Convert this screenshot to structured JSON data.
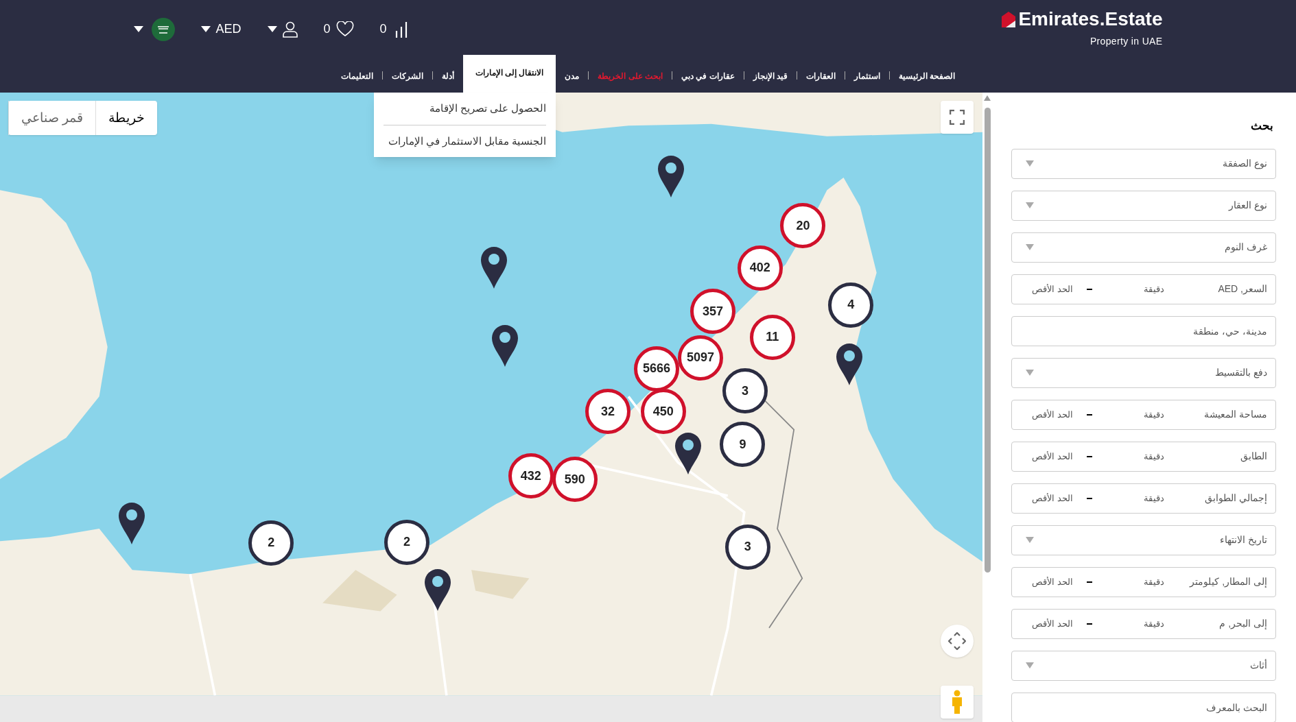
{
  "header": {
    "logo": {
      "title": "Emirates.Estate",
      "tagline": "Property in UAE"
    },
    "compare_count": "0",
    "favorites_count": "0",
    "currency": "AED"
  },
  "nav": [
    {
      "label": "الصفحة الرئيسية",
      "selected": false,
      "highlight": false
    },
    {
      "label": "استثمار",
      "selected": false,
      "highlight": false
    },
    {
      "label": "العقارات",
      "selected": false,
      "highlight": false
    },
    {
      "label": "قيد الإنجاز",
      "selected": false,
      "highlight": false
    },
    {
      "label": "عقارات في دبي",
      "selected": false,
      "highlight": false
    },
    {
      "label": "ابحث على الخريطة",
      "selected": false,
      "highlight": true
    },
    {
      "label": "مدن",
      "selected": false,
      "highlight": false
    },
    {
      "label": "الانتقال إلى الإمارات",
      "selected": true,
      "highlight": false,
      "submenu": [
        "الحصول على تصريح الإقامة",
        "الجنسية مقابل الاستثمار في الإمارات"
      ]
    },
    {
      "label": "أدلة",
      "selected": false,
      "highlight": false
    },
    {
      "label": "الشركات",
      "selected": false,
      "highlight": false
    },
    {
      "label": "التعليمات",
      "selected": false,
      "highlight": false
    }
  ],
  "map": {
    "map_types": [
      {
        "label": "خريطة",
        "selected": true
      },
      {
        "label": "قمر صناعي",
        "selected": false
      }
    ],
    "clusters": [
      {
        "count": "20",
        "color": "#d0112b"
      },
      {
        "count": "402",
        "color": "#d0112b"
      },
      {
        "count": "4",
        "color": "#2b2d42"
      },
      {
        "count": "357",
        "color": "#d0112b"
      },
      {
        "count": "11",
        "color": "#d0112b"
      },
      {
        "count": "5097",
        "color": "#d0112b"
      },
      {
        "count": "5666",
        "color": "#d0112b"
      },
      {
        "count": "3",
        "color": "#2b2d42"
      },
      {
        "count": "32",
        "color": "#d0112b"
      },
      {
        "count": "450",
        "color": "#d0112b"
      },
      {
        "count": "9",
        "color": "#2b2d42"
      },
      {
        "count": "432",
        "color": "#d0112b"
      },
      {
        "count": "590",
        "color": "#d0112b"
      },
      {
        "count": "2",
        "color": "#2b2d42"
      },
      {
        "count": "2",
        "color": "#2b2d42"
      },
      {
        "count": "3",
        "color": "#2b2d42"
      }
    ]
  },
  "sidebar": {
    "title": "بحث",
    "fields": [
      {
        "kind": "select",
        "label": "نوع الصفقة"
      },
      {
        "kind": "select",
        "label": "نوع العقار"
      },
      {
        "kind": "select",
        "label": "غرف النوم"
      },
      {
        "kind": "range",
        "label": "السعر, AED",
        "min_placeholder": "دقيقة",
        "max_placeholder": "الحد الأقص"
      },
      {
        "kind": "text",
        "placeholder": "مدينة، حي، منطقة"
      },
      {
        "kind": "select",
        "label": "دفع بالتقسيط"
      },
      {
        "kind": "range",
        "label": "مساحة المعيشة",
        "min_placeholder": "دقيقة",
        "max_placeholder": "الحد الأقص"
      },
      {
        "kind": "range",
        "label": "الطابق",
        "min_placeholder": "دقيقة",
        "max_placeholder": "الحد الأقص"
      },
      {
        "kind": "range",
        "label": "إجمالي الطوابق",
        "min_placeholder": "دقيقة",
        "max_placeholder": "الحد الأقص"
      },
      {
        "kind": "select",
        "label": "تاريخ الانتهاء"
      },
      {
        "kind": "range",
        "label": "إلى المطار, كيلومتر",
        "min_placeholder": "دقيقة",
        "max_placeholder": "الحد الأقص"
      },
      {
        "kind": "range",
        "label": "إلى البحر, م",
        "min_placeholder": "دقيقة",
        "max_placeholder": "الحد الأقص"
      },
      {
        "kind": "select",
        "label": "أثاث"
      },
      {
        "kind": "text",
        "placeholder": "البحث بالمعرف"
      }
    ]
  }
}
